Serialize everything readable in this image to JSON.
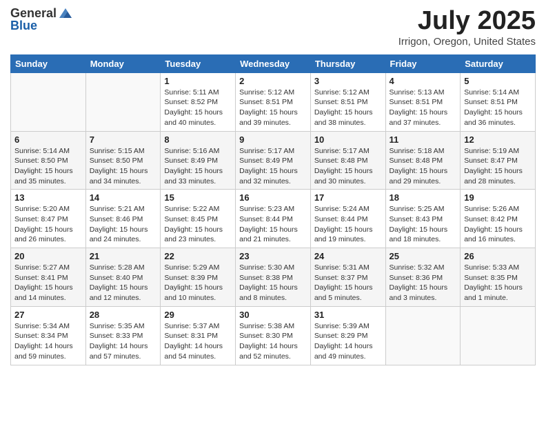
{
  "header": {
    "logo_general": "General",
    "logo_blue": "Blue",
    "title": "July 2025",
    "location": "Irrigon, Oregon, United States"
  },
  "days_of_week": [
    "Sunday",
    "Monday",
    "Tuesday",
    "Wednesday",
    "Thursday",
    "Friday",
    "Saturday"
  ],
  "weeks": [
    [
      {
        "day": "",
        "info": ""
      },
      {
        "day": "",
        "info": ""
      },
      {
        "day": "1",
        "info": "Sunrise: 5:11 AM\nSunset: 8:52 PM\nDaylight: 15 hours and 40 minutes."
      },
      {
        "day": "2",
        "info": "Sunrise: 5:12 AM\nSunset: 8:51 PM\nDaylight: 15 hours and 39 minutes."
      },
      {
        "day": "3",
        "info": "Sunrise: 5:12 AM\nSunset: 8:51 PM\nDaylight: 15 hours and 38 minutes."
      },
      {
        "day": "4",
        "info": "Sunrise: 5:13 AM\nSunset: 8:51 PM\nDaylight: 15 hours and 37 minutes."
      },
      {
        "day": "5",
        "info": "Sunrise: 5:14 AM\nSunset: 8:51 PM\nDaylight: 15 hours and 36 minutes."
      }
    ],
    [
      {
        "day": "6",
        "info": "Sunrise: 5:14 AM\nSunset: 8:50 PM\nDaylight: 15 hours and 35 minutes."
      },
      {
        "day": "7",
        "info": "Sunrise: 5:15 AM\nSunset: 8:50 PM\nDaylight: 15 hours and 34 minutes."
      },
      {
        "day": "8",
        "info": "Sunrise: 5:16 AM\nSunset: 8:49 PM\nDaylight: 15 hours and 33 minutes."
      },
      {
        "day": "9",
        "info": "Sunrise: 5:17 AM\nSunset: 8:49 PM\nDaylight: 15 hours and 32 minutes."
      },
      {
        "day": "10",
        "info": "Sunrise: 5:17 AM\nSunset: 8:48 PM\nDaylight: 15 hours and 30 minutes."
      },
      {
        "day": "11",
        "info": "Sunrise: 5:18 AM\nSunset: 8:48 PM\nDaylight: 15 hours and 29 minutes."
      },
      {
        "day": "12",
        "info": "Sunrise: 5:19 AM\nSunset: 8:47 PM\nDaylight: 15 hours and 28 minutes."
      }
    ],
    [
      {
        "day": "13",
        "info": "Sunrise: 5:20 AM\nSunset: 8:47 PM\nDaylight: 15 hours and 26 minutes."
      },
      {
        "day": "14",
        "info": "Sunrise: 5:21 AM\nSunset: 8:46 PM\nDaylight: 15 hours and 24 minutes."
      },
      {
        "day": "15",
        "info": "Sunrise: 5:22 AM\nSunset: 8:45 PM\nDaylight: 15 hours and 23 minutes."
      },
      {
        "day": "16",
        "info": "Sunrise: 5:23 AM\nSunset: 8:44 PM\nDaylight: 15 hours and 21 minutes."
      },
      {
        "day": "17",
        "info": "Sunrise: 5:24 AM\nSunset: 8:44 PM\nDaylight: 15 hours and 19 minutes."
      },
      {
        "day": "18",
        "info": "Sunrise: 5:25 AM\nSunset: 8:43 PM\nDaylight: 15 hours and 18 minutes."
      },
      {
        "day": "19",
        "info": "Sunrise: 5:26 AM\nSunset: 8:42 PM\nDaylight: 15 hours and 16 minutes."
      }
    ],
    [
      {
        "day": "20",
        "info": "Sunrise: 5:27 AM\nSunset: 8:41 PM\nDaylight: 15 hours and 14 minutes."
      },
      {
        "day": "21",
        "info": "Sunrise: 5:28 AM\nSunset: 8:40 PM\nDaylight: 15 hours and 12 minutes."
      },
      {
        "day": "22",
        "info": "Sunrise: 5:29 AM\nSunset: 8:39 PM\nDaylight: 15 hours and 10 minutes."
      },
      {
        "day": "23",
        "info": "Sunrise: 5:30 AM\nSunset: 8:38 PM\nDaylight: 15 hours and 8 minutes."
      },
      {
        "day": "24",
        "info": "Sunrise: 5:31 AM\nSunset: 8:37 PM\nDaylight: 15 hours and 5 minutes."
      },
      {
        "day": "25",
        "info": "Sunrise: 5:32 AM\nSunset: 8:36 PM\nDaylight: 15 hours and 3 minutes."
      },
      {
        "day": "26",
        "info": "Sunrise: 5:33 AM\nSunset: 8:35 PM\nDaylight: 15 hours and 1 minute."
      }
    ],
    [
      {
        "day": "27",
        "info": "Sunrise: 5:34 AM\nSunset: 8:34 PM\nDaylight: 14 hours and 59 minutes."
      },
      {
        "day": "28",
        "info": "Sunrise: 5:35 AM\nSunset: 8:33 PM\nDaylight: 14 hours and 57 minutes."
      },
      {
        "day": "29",
        "info": "Sunrise: 5:37 AM\nSunset: 8:31 PM\nDaylight: 14 hours and 54 minutes."
      },
      {
        "day": "30",
        "info": "Sunrise: 5:38 AM\nSunset: 8:30 PM\nDaylight: 14 hours and 52 minutes."
      },
      {
        "day": "31",
        "info": "Sunrise: 5:39 AM\nSunset: 8:29 PM\nDaylight: 14 hours and 49 minutes."
      },
      {
        "day": "",
        "info": ""
      },
      {
        "day": "",
        "info": ""
      }
    ]
  ]
}
